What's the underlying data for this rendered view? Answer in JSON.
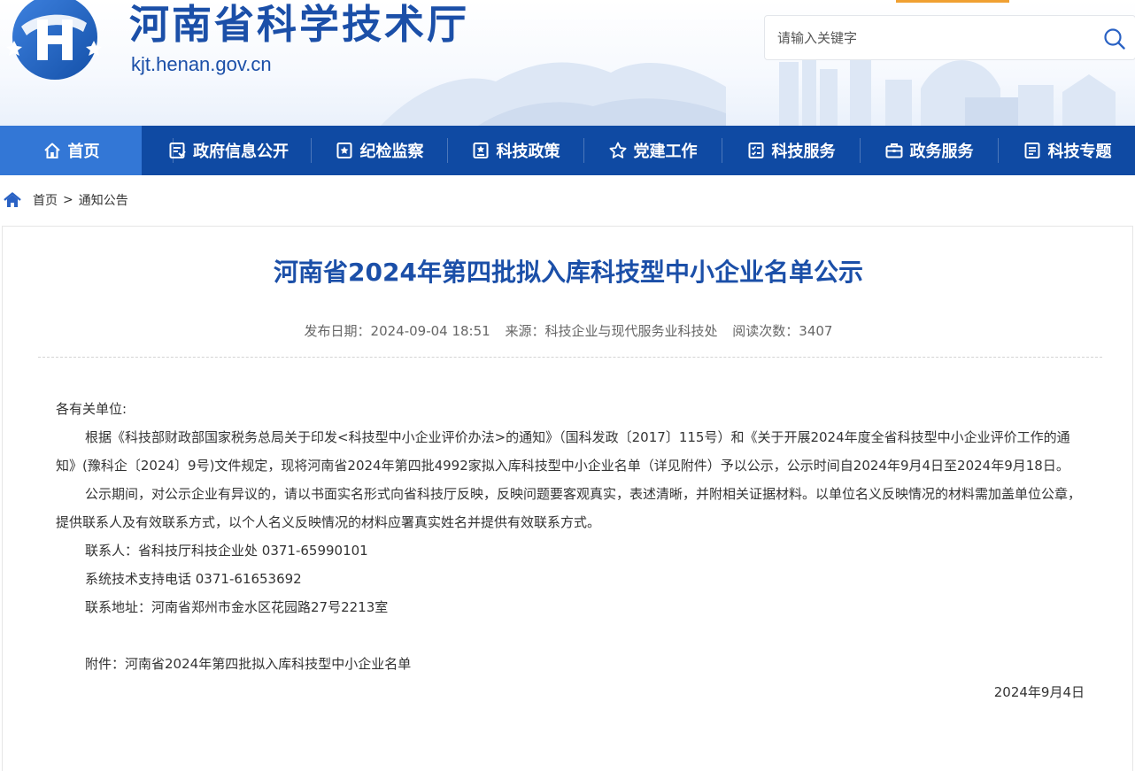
{
  "site": {
    "title": "河南省科学技术厅",
    "domain": "kjt.henan.gov.cn"
  },
  "search": {
    "placeholder": "请输入关键字"
  },
  "nav": {
    "items": [
      {
        "label": "首页",
        "icon": "home-icon"
      },
      {
        "label": "政府信息公开",
        "icon": "info-open-icon"
      },
      {
        "label": "纪检监察",
        "icon": "inspection-icon"
      },
      {
        "label": "科技政策",
        "icon": "policy-icon"
      },
      {
        "label": "党建工作",
        "icon": "star-icon"
      },
      {
        "label": "科技服务",
        "icon": "checklist-icon"
      },
      {
        "label": "政务服务",
        "icon": "briefcase-icon"
      },
      {
        "label": "科技专题",
        "icon": "topic-icon"
      }
    ]
  },
  "breadcrumb": {
    "home": "首页",
    "separator": ">",
    "current": "通知公告"
  },
  "article": {
    "title": "河南省2024年第四批拟入库科技型中小企业名单公示",
    "publish_date": "发布日期：2024-09-04 18:51",
    "source": "来源：科技企业与现代服务业科技处",
    "views": "阅读次数：3407",
    "salutation": "各有关单位:",
    "para1": "根据《科技部财政部国家税务总局关于印发<科技型中小企业评价办法>的通知》（国科发政〔2017〕115号）和《关于开展2024年度全省科技型中小企业评价工作的通知》(豫科企〔2024〕9号)文件规定，现将河南省2024年第四批4992家拟入库科技型中小企业名单（详见附件）予以公示，公示时间自2024年9月4日至2024年9月18日。",
    "para2": "公示期间，对公示企业有异议的，请以书面实名形式向省科技厅反映，反映问题要客观真实，表述清晰，并附相关证据材料。以单位名义反映情况的材料需加盖单位公章，提供联系人及有效联系方式，以个人名义反映情况的材料应署真实姓名并提供有效联系方式。",
    "contact": "联系人：省科技厅科技企业处  0371-65990101",
    "tech_support": "系统技术支持电话  0371-61653692",
    "address": "联系地址：河南省郑州市金水区花园路27号2213室",
    "attachment_label": "附件：",
    "attachment_link": "河南省2024年第四批拟入库科技型中小企业名单",
    "date": "2024年9月4日"
  },
  "colors": {
    "brand_blue": "#1b4fa8",
    "nav_bg": "#0f4aa3",
    "nav_active": "#3377d6"
  }
}
